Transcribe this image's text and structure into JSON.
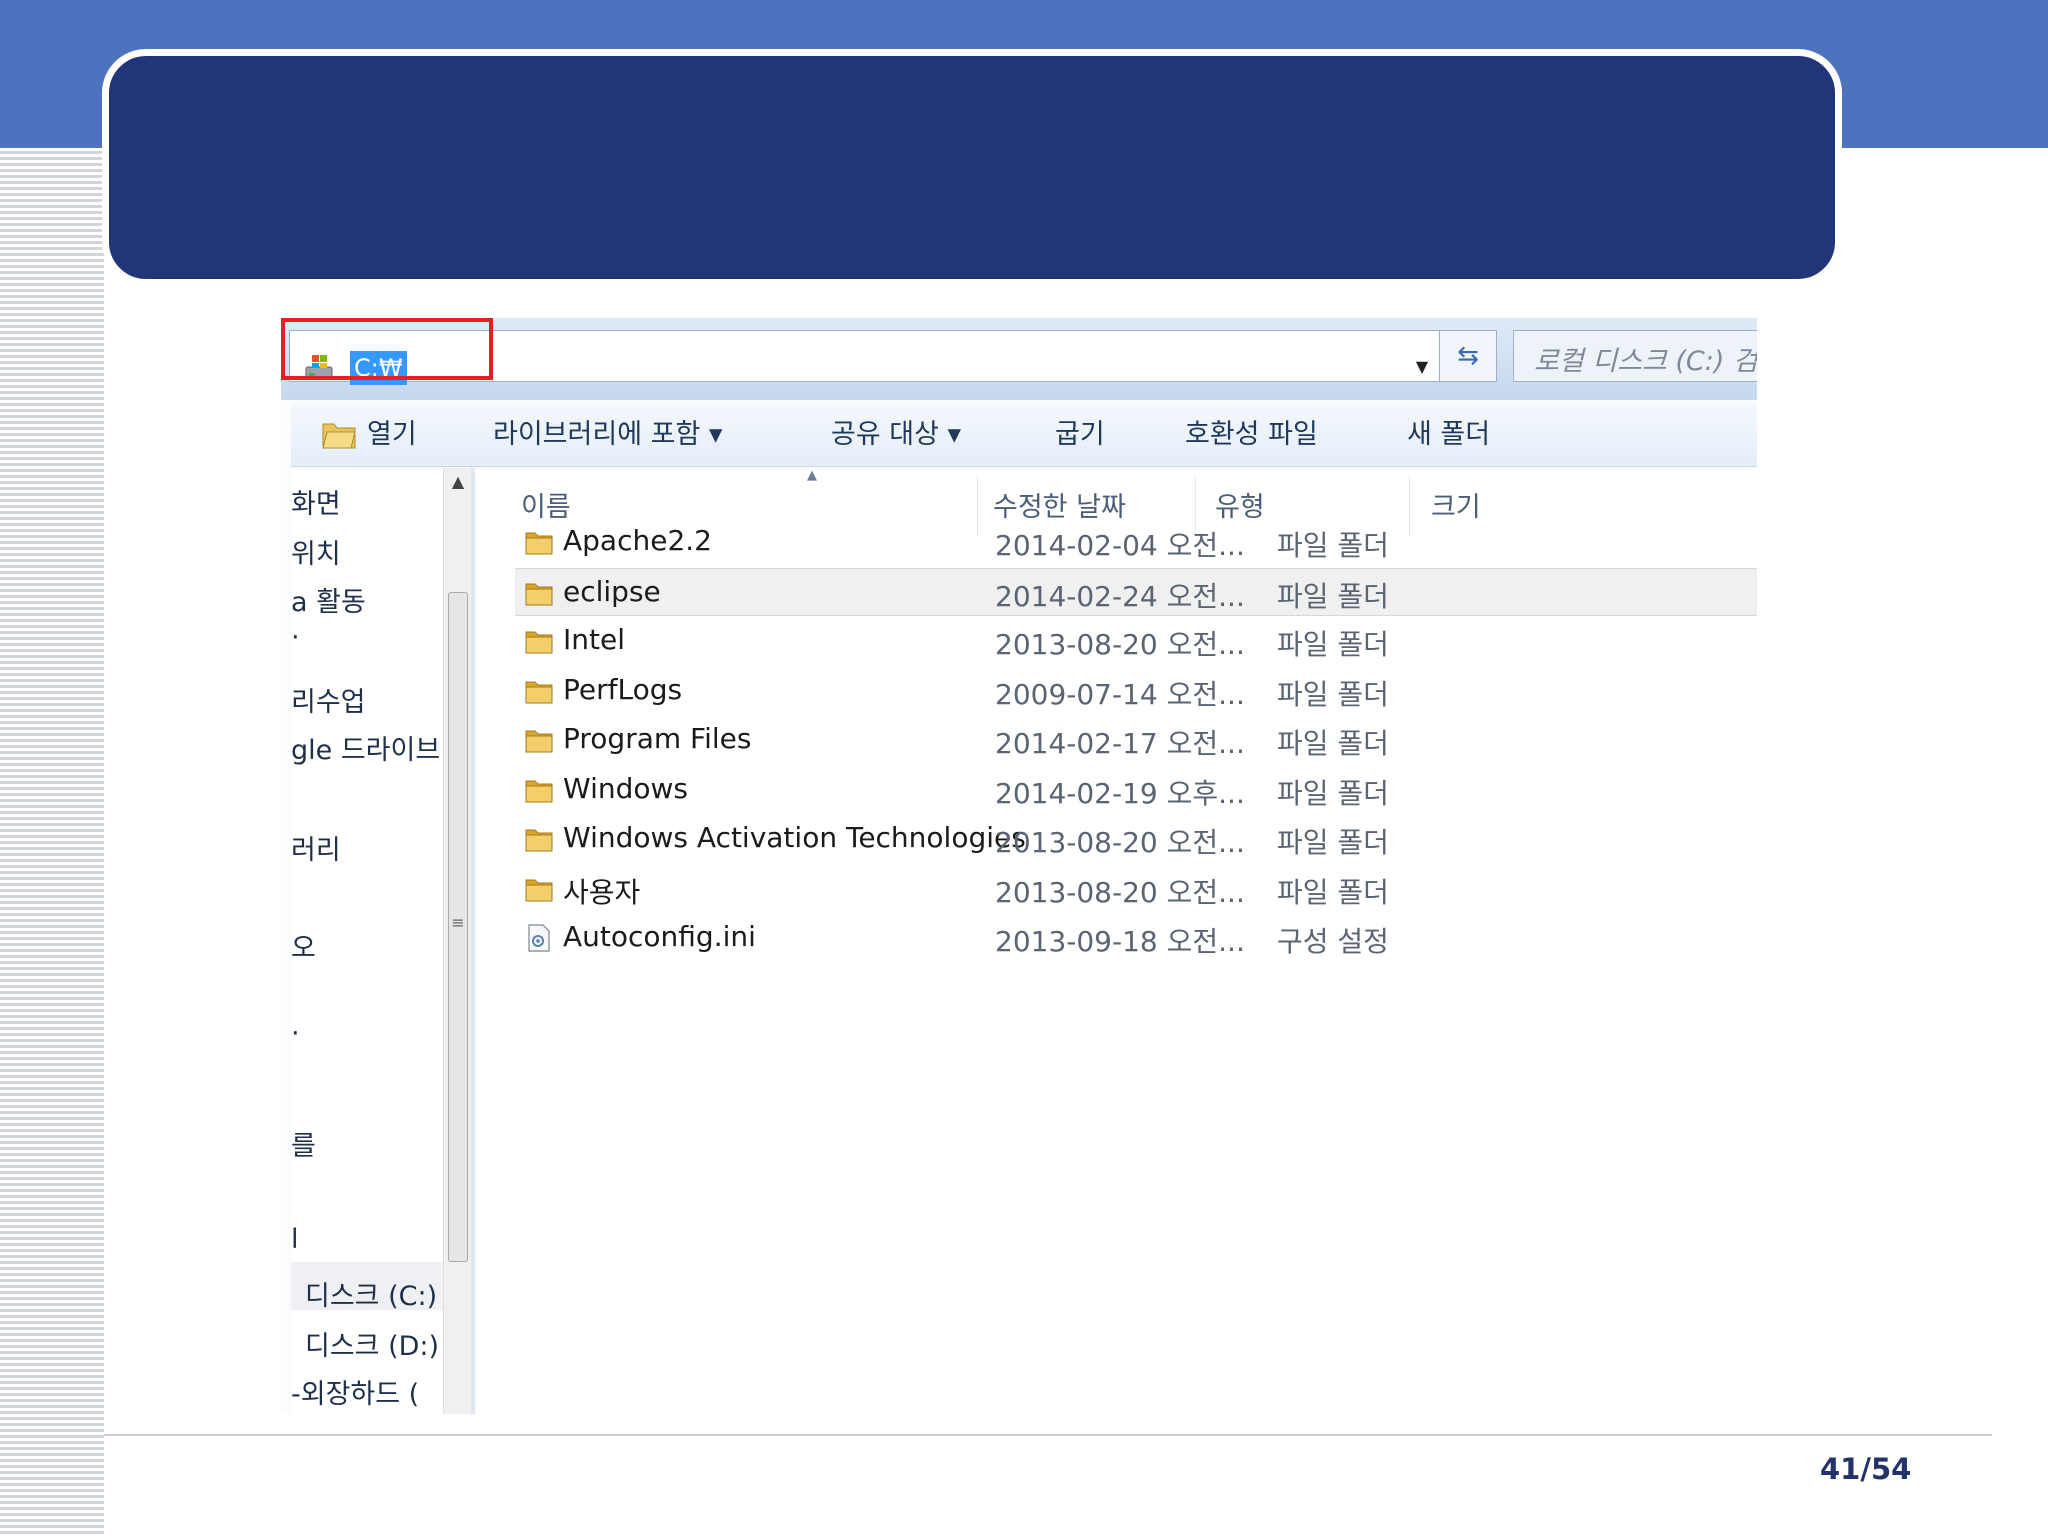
{
  "slide": {
    "page_number": "41/54"
  },
  "explorer": {
    "address": {
      "path": "C:₩",
      "search_placeholder": "로컬 디스크 (C:) 검"
    },
    "toolbar": {
      "open": "열기",
      "include_in_library": "라이브러리에 포함 ▾",
      "share_with": "공유 대상 ▾",
      "burn": "굽기",
      "compatibility_files": "호환성 파일",
      "new_folder": "새 폴더"
    },
    "nav_pane": {
      "items": [
        "화면",
        "위치",
        "a 활동",
        "·",
        "리수업",
        "gle 드라이브",
        "러리",
        "오",
        "·",
        "를",
        "l",
        "디스크 (C:)",
        "디스크 (D:)",
        "-외장하드 ("
      ]
    },
    "columns": {
      "name": "이름",
      "date_modified": "수정한 날짜",
      "type": "유형",
      "size": "크기"
    },
    "files": [
      {
        "name": "Apache2.2",
        "date": "2014-02-04 오전...",
        "type": "파일 폴더",
        "icon": "folder-icon"
      },
      {
        "name": "eclipse",
        "date": "2014-02-24 오전...",
        "type": "파일 폴더",
        "icon": "folder-icon"
      },
      {
        "name": "Intel",
        "date": "2013-08-20 오전...",
        "type": "파일 폴더",
        "icon": "folder-icon"
      },
      {
        "name": "PerfLogs",
        "date": "2009-07-14 오전...",
        "type": "파일 폴더",
        "icon": "folder-icon"
      },
      {
        "name": "Program Files",
        "date": "2014-02-17 오전...",
        "type": "파일 폴더",
        "icon": "folder-icon"
      },
      {
        "name": "Windows",
        "date": "2014-02-19 오후...",
        "type": "파일 폴더",
        "icon": "folder-icon"
      },
      {
        "name": "Windows Activation Technologies",
        "date": "2013-08-20 오전...",
        "type": "파일 폴더",
        "icon": "folder-icon"
      },
      {
        "name": "사용자",
        "date": "2013-08-20 오전...",
        "type": "파일 폴더",
        "icon": "folder-icon"
      },
      {
        "name": "Autoconfig.ini",
        "date": "2013-09-18 오전...",
        "type": "구성 설정",
        "icon": "config-file-icon"
      }
    ],
    "selected_file": "eclipse",
    "colors": {
      "highlight_border": "#ea1c24",
      "selection_text_bg": "#3399ff",
      "title_card": "#233579",
      "top_band": "#4e73be"
    }
  }
}
